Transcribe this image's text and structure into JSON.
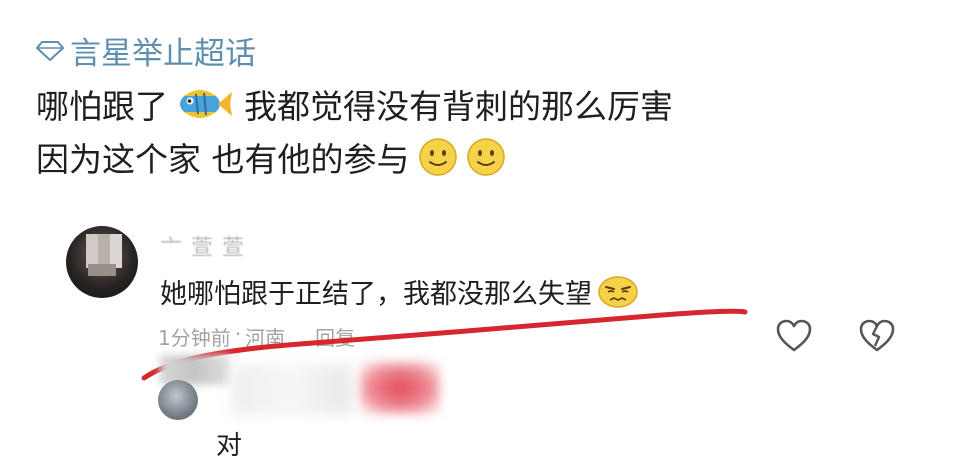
{
  "topic": {
    "icon": "diamond-topic-icon",
    "label": "言星举止超话",
    "color": "#5f8fb0"
  },
  "post": {
    "line1_before": "哪怕跟了",
    "line1_emoji": "fish-emoji",
    "line1_after": "我都觉得没有背刺的那么厉害",
    "line2_text": "因为这个家 也有他的参与",
    "line2_emojis": [
      "smile-emoji",
      "smile-emoji"
    ]
  },
  "comment": {
    "username": "亠 萱 萱",
    "text": "她哪怕跟于正结了，我都没那么失望",
    "emoji": "awkward-emoji",
    "time": "1分钟前",
    "separator": "·",
    "location": "河南",
    "reply_label": "回复",
    "like_icon": "heart-outline-icon",
    "dislike_icon": "broken-heart-icon",
    "annotation_color": "#d7262f"
  },
  "reply": {
    "text": "对"
  }
}
